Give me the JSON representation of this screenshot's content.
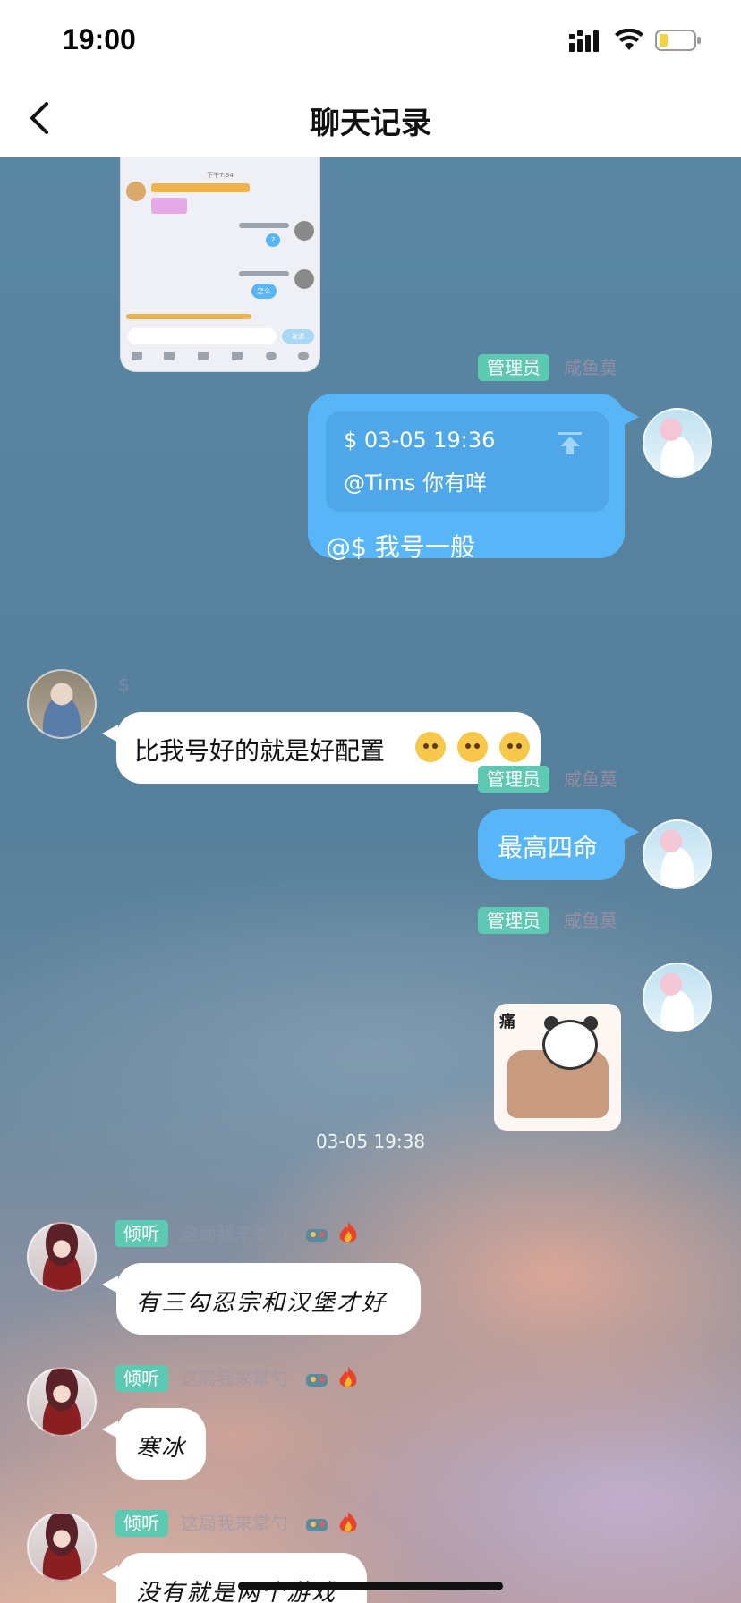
{
  "status_bar": {
    "time": "19:00"
  },
  "nav": {
    "title": "聊天记录"
  },
  "messages": [
    {
      "role": "admin",
      "badge": "管理员",
      "sender": "咸鱼莫",
      "quote": {
        "header": "$ 03-05 19:36",
        "text": "@Tims 你有咩"
      },
      "text": "@$ 我号一般"
    },
    {
      "role": "member",
      "sender": "$",
      "text": "比我号好的就是好配置"
    },
    {
      "role": "admin",
      "badge": "管理员",
      "sender": "咸鱼莫",
      "text": "最高四命"
    },
    {
      "role": "admin",
      "badge": "管理员",
      "sender": "咸鱼莫",
      "sticker_label": "痛"
    }
  ],
  "timestamp": "03-05 19:38",
  "later_messages": [
    {
      "badge": "倾听",
      "sender": "这局我来掌勺",
      "text": "有三勾忍宗和汉堡才好"
    },
    {
      "badge": "倾听",
      "sender": "这局我来掌勺",
      "text": "寒冰"
    },
    {
      "badge": "倾听",
      "sender": "这局我来掌勺",
      "text": "没有就是两个游戏"
    }
  ],
  "thumbnail": {
    "time": "下午7:34",
    "bubble1": "?",
    "bubble2": "怎么",
    "send": "发送"
  },
  "colors": {
    "accent_blue": "#58b5f8",
    "badge_teal": "#5ec9b3"
  },
  "icons": [
    "back-arrow-icon",
    "signal-icon",
    "wifi-icon",
    "battery-icon",
    "pin-top-icon",
    "fire-icon",
    "game-icon"
  ]
}
